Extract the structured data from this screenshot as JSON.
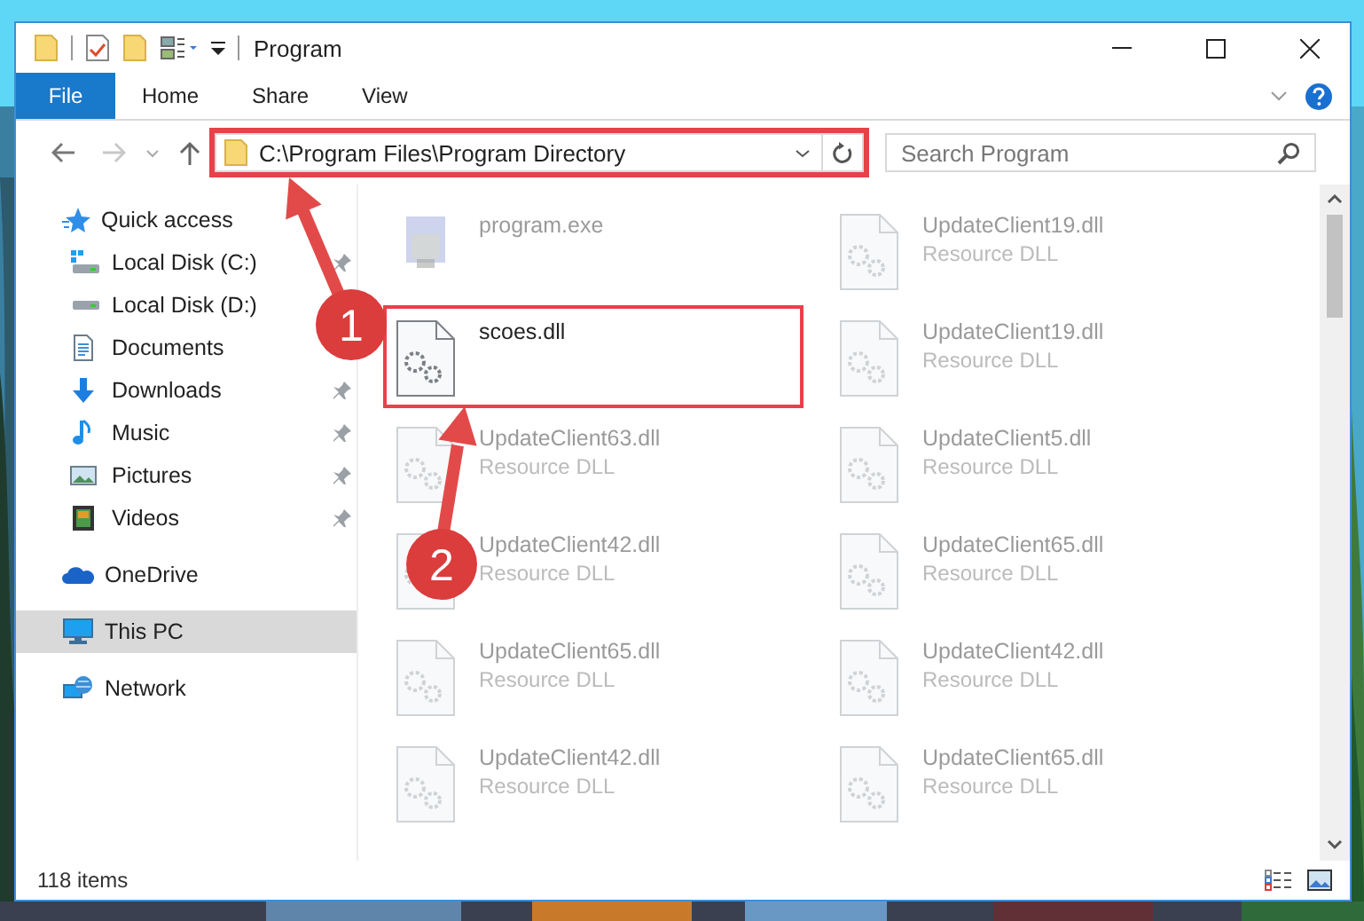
{
  "window": {
    "title": "Program"
  },
  "ribbon": {
    "tabs": [
      {
        "label": "File",
        "kind": "file"
      },
      {
        "label": "Home",
        "kind": "tab"
      },
      {
        "label": "Share",
        "kind": "tab"
      },
      {
        "label": "View",
        "kind": "tab"
      }
    ]
  },
  "address_bar": {
    "path": "C:\\Program Files\\Program Directory",
    "highlighted": true
  },
  "search": {
    "placeholder": "Search Program"
  },
  "navigation": {
    "items": [
      {
        "label": "Quick access",
        "kind": "star",
        "selected": false,
        "children": [
          {
            "label": "Local Disk (C:)",
            "kind": "drive-system",
            "pinned": true
          },
          {
            "label": "Local Disk (D:)",
            "kind": "drive",
            "pinned": false
          },
          {
            "label": "Documents",
            "kind": "document",
            "pinned": false
          },
          {
            "label": "Downloads",
            "kind": "download",
            "pinned": true
          },
          {
            "label": "Music",
            "kind": "music",
            "pinned": true
          },
          {
            "label": "Pictures",
            "kind": "pictures",
            "pinned": true
          },
          {
            "label": "Videos",
            "kind": "videos",
            "pinned": true
          }
        ]
      },
      {
        "label": "OneDrive",
        "kind": "cloud",
        "selected": false
      },
      {
        "label": "This PC",
        "kind": "computer",
        "selected": true
      },
      {
        "label": "Network",
        "kind": "network",
        "selected": false
      }
    ]
  },
  "files": [
    {
      "name": "program.exe",
      "kind": "exe",
      "blurred": true,
      "highlighted": false
    },
    {
      "name": "UpdateClient19.dll",
      "type": "Resource DLL",
      "kind": "dll",
      "blurred": true,
      "highlighted": false
    },
    {
      "name": "scoes.dll",
      "kind": "dll",
      "blurred": false,
      "highlighted": true
    },
    {
      "name": "UpdateClient19.dll",
      "type": "Resource DLL",
      "kind": "dll",
      "blurred": true,
      "highlighted": false
    },
    {
      "name": "UpdateClient63.dll",
      "type": "Resource DLL",
      "kind": "dll",
      "blurred": true,
      "highlighted": false
    },
    {
      "name": "UpdateClient5.dll",
      "type": "Resource DLL",
      "kind": "dll",
      "blurred": true,
      "highlighted": false
    },
    {
      "name": "UpdateClient42.dll",
      "type": "Resource DLL",
      "kind": "dll",
      "blurred": true,
      "highlighted": false
    },
    {
      "name": "UpdateClient65.dll",
      "type": "Resource DLL",
      "kind": "dll",
      "blurred": true,
      "highlighted": false
    },
    {
      "name": "UpdateClient65.dll",
      "type": "Resource DLL",
      "kind": "dll",
      "blurred": true,
      "highlighted": false
    },
    {
      "name": "UpdateClient42.dll",
      "type": "Resource DLL",
      "kind": "dll",
      "blurred": true,
      "highlighted": false
    },
    {
      "name": "UpdateClient42.dll",
      "type": "Resource DLL",
      "kind": "dll",
      "blurred": true,
      "highlighted": false
    },
    {
      "name": "UpdateClient65.dll",
      "type": "Resource DLL",
      "kind": "dll",
      "blurred": true,
      "highlighted": false
    }
  ],
  "status_bar": {
    "item_count": "118 items"
  },
  "callouts": [
    {
      "label": "1"
    },
    {
      "label": "2"
    }
  ]
}
